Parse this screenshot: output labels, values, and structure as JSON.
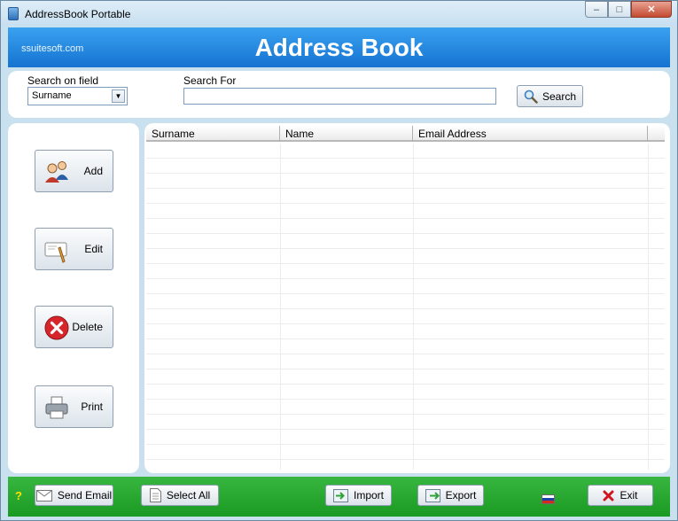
{
  "window": {
    "title": "AddressBook Portable",
    "controls": {
      "minimize": "‒",
      "maximize": "□",
      "close": "✕"
    }
  },
  "banner": {
    "site": "ssuitesoft.com",
    "title": "Address Book"
  },
  "search": {
    "field_label": "Search on field",
    "field_value": "Surname",
    "for_label": "Search For",
    "for_value": "",
    "button_label": "Search"
  },
  "sidebar": {
    "add_label": "Add",
    "edit_label": "Edit",
    "delete_label": "Delete",
    "print_label": "Print"
  },
  "table": {
    "columns": [
      "Surname",
      "Name",
      "Email Address"
    ],
    "rows": []
  },
  "bottom": {
    "help": "?",
    "send_email_label": "Send Email",
    "select_all_label": "Select All",
    "import_label": "Import",
    "export_label": "Export",
    "exit_label": "Exit"
  },
  "colors": {
    "banner": "#1f86dd",
    "bottom_bar": "#28a930",
    "frame": "#c9e1ef",
    "help_text": "#ffe100"
  }
}
